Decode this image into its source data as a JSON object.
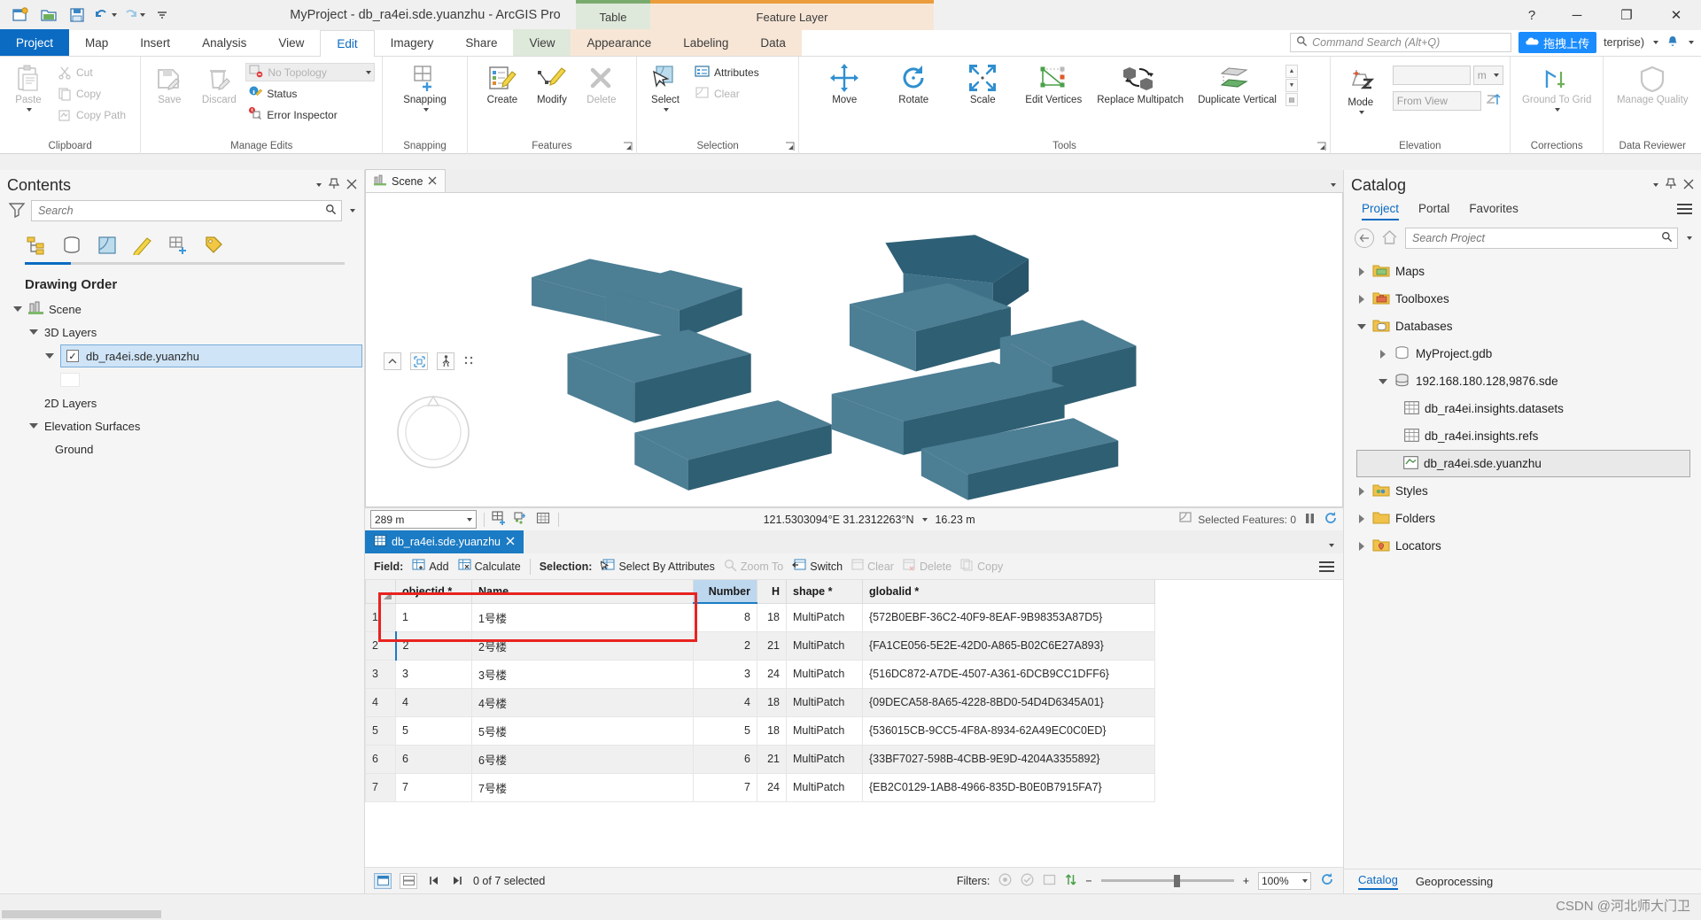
{
  "app": {
    "title": "MyProject - db_ra4ei.sde.yuanzhu - ArcGIS Pro",
    "help_glyph": "?",
    "minimize_glyph": "─",
    "maximize_glyph": "❐",
    "close_glyph": "✕"
  },
  "quick_access": [
    {
      "name": "new-project-icon",
      "label": "New Project"
    },
    {
      "name": "open-project-icon",
      "label": "Open Project"
    },
    {
      "name": "save-project-icon",
      "label": "Save Project"
    },
    {
      "name": "undo-icon",
      "label": "Undo"
    },
    {
      "name": "redo-icon",
      "label": "Redo"
    },
    {
      "name": "customize-qat-icon",
      "label": "Customize Quick Access Toolbar"
    }
  ],
  "contextual_groups": [
    {
      "label": "Table",
      "color": "#7aab6e"
    },
    {
      "label": "Feature Layer",
      "color": "#eb9c3c"
    }
  ],
  "tabs": [
    {
      "label": "Project",
      "state": "backstage"
    },
    {
      "label": "Map",
      "state": "normal"
    },
    {
      "label": "Insert",
      "state": "normal"
    },
    {
      "label": "Analysis",
      "state": "normal"
    },
    {
      "label": "View",
      "state": "normal"
    },
    {
      "label": "Edit",
      "state": "active"
    },
    {
      "label": "Imagery",
      "state": "normal"
    },
    {
      "label": "Share",
      "state": "normal"
    },
    {
      "label": "View",
      "state": "ctx-green"
    },
    {
      "label": "Appearance",
      "state": "ctx-orange"
    },
    {
      "label": "Labeling",
      "state": "ctx-orange"
    },
    {
      "label": "Data",
      "state": "ctx-orange"
    }
  ],
  "command_search": {
    "placeholder": "Command Search (Alt+Q)",
    "icon": "search-icon"
  },
  "header_right": {
    "upload_chip": "拖拽上传",
    "enterprise_label": "terprise)",
    "notification_icon": "bell-icon"
  },
  "ribbon": {
    "groups": [
      {
        "name": "clipboard",
        "label": "Clipboard",
        "big": [
          {
            "label": "Paste",
            "icon": "paste-icon",
            "dropdown": true,
            "disabled": true
          }
        ],
        "small": [
          {
            "label": "Cut",
            "icon": "cut-icon",
            "disabled": true
          },
          {
            "label": "Copy",
            "icon": "copy-icon",
            "disabled": true
          },
          {
            "label": "Copy Path",
            "icon": "copy-path-icon",
            "disabled": true
          }
        ]
      },
      {
        "name": "manage-edits",
        "label": "Manage Edits",
        "big": [
          {
            "label": "Save",
            "icon": "save-edits-icon",
            "disabled": true
          },
          {
            "label": "Discard",
            "icon": "discard-edits-icon",
            "disabled": true
          }
        ],
        "small": [
          {
            "label": "No Topology",
            "icon": "topology-icon",
            "disabled": true,
            "dropdown": true
          },
          {
            "label": "Status",
            "icon": "status-icon",
            "disabled": false
          },
          {
            "label": "Error Inspector",
            "icon": "error-inspector-icon",
            "disabled": false
          }
        ]
      },
      {
        "name": "snapping",
        "label": "Snapping",
        "big": [
          {
            "label": "Snapping",
            "icon": "snapping-icon",
            "dropdown": true
          }
        ],
        "small": []
      },
      {
        "name": "features",
        "label": "Features",
        "big": [
          {
            "label": "Create",
            "icon": "create-features-icon"
          },
          {
            "label": "Modify",
            "icon": "modify-features-icon"
          },
          {
            "label": "Delete",
            "icon": "delete-features-icon",
            "disabled": true
          }
        ],
        "small": []
      },
      {
        "name": "selection",
        "label": "Selection",
        "big": [
          {
            "label": "Select",
            "icon": "select-icon",
            "dropdown": true
          }
        ],
        "small": [
          {
            "label": "Attributes",
            "icon": "attributes-icon"
          },
          {
            "label": "Clear",
            "icon": "clear-selection-icon",
            "disabled": true
          }
        ]
      },
      {
        "name": "tools",
        "label": "Tools",
        "big": [
          {
            "label": "Move",
            "icon": "move-icon"
          },
          {
            "label": "Rotate",
            "icon": "rotate-icon"
          },
          {
            "label": "Scale",
            "icon": "scale-icon"
          },
          {
            "label": "Edit Vertices",
            "icon": "edit-vertices-icon"
          },
          {
            "label": "Replace Multipatch",
            "icon": "replace-multipatch-icon"
          },
          {
            "label": "Duplicate Vertical",
            "icon": "duplicate-vertical-icon"
          }
        ],
        "small": []
      },
      {
        "name": "elevation",
        "label": "Elevation",
        "big": [
          {
            "label": "Mode",
            "icon": "elevation-mode-icon",
            "dropdown": true
          }
        ],
        "fields": [
          {
            "name": "elevation-value",
            "value": "",
            "unit": "m"
          },
          {
            "name": "elevation-source",
            "value": "From View"
          }
        ]
      },
      {
        "name": "corrections",
        "label": "Corrections",
        "big": [
          {
            "label": "Ground To Grid",
            "icon": "ground-to-grid-icon",
            "dropdown": true,
            "disabled": true
          }
        ],
        "small": []
      },
      {
        "name": "data-reviewer",
        "label": "Data Reviewer",
        "big": [
          {
            "label": "Manage Quality",
            "icon": "manage-quality-icon",
            "disabled": true
          }
        ],
        "small": []
      }
    ]
  },
  "contents": {
    "title": "Contents",
    "search_placeholder": "Search",
    "tab_icons": [
      "list-by-drawing-order-icon",
      "list-by-data-source-icon",
      "list-by-selection-icon",
      "list-by-editing-icon",
      "list-by-snapping-icon",
      "list-by-labeling-icon"
    ],
    "section_title": "Drawing Order",
    "tree": [
      {
        "label": "Scene",
        "level": 0,
        "icon": "scene-icon",
        "expanded": true
      },
      {
        "label": "3D Layers",
        "level": 1,
        "expanded": true
      },
      {
        "label": "db_ra4ei.sde.yuanzhu",
        "level": 2,
        "expanded": true,
        "checked": true,
        "selected": true
      },
      {
        "label": "2D Layers",
        "level": 1,
        "expanded": false
      },
      {
        "label": "Elevation Surfaces",
        "level": 1,
        "expanded": true
      },
      {
        "label": "Ground",
        "level": 2
      }
    ]
  },
  "scene_view": {
    "tab_label": "Scene",
    "tab_icon": "scene-tab-icon",
    "scale": "289 m",
    "coordinates": "121.5303094°E 31.2312263°N",
    "elevation": "16.23 m",
    "selected_features": "Selected Features: 0",
    "nav_icons": [
      "collapse-icon",
      "full-control-icon",
      "walk-mode-icon",
      "more-nav-icon"
    ],
    "bottom_icons": [
      "add-layer-icon",
      "xy-events-icon",
      "grid-icon"
    ],
    "pause_icon": "pause-drawing-icon",
    "refresh_icon": "refresh-icon"
  },
  "table": {
    "tab_label": "db_ra4ei.sde.yuanzhu",
    "tab_icon": "table-icon",
    "toolbar": {
      "field_label": "Field:",
      "add": "Add",
      "calculate": "Calculate",
      "selection_label": "Selection:",
      "select_by_attributes": "Select By Attributes",
      "zoom_to": "Zoom To",
      "switch": "Switch",
      "clear": "Clear",
      "delete": "Delete",
      "copy": "Copy",
      "menu_icon": "table-options-icon"
    },
    "columns": [
      {
        "label": "objectid *",
        "key": "objectid",
        "align": "left"
      },
      {
        "label": "Name",
        "key": "name",
        "align": "left"
      },
      {
        "label": "Number",
        "key": "number",
        "align": "right",
        "highlighted": true
      },
      {
        "label": "H",
        "key": "h",
        "align": "right"
      },
      {
        "label": "shape *",
        "key": "shape",
        "align": "left"
      },
      {
        "label": "globalid *",
        "key": "globalid",
        "align": "left"
      }
    ],
    "rows": [
      {
        "row": "1",
        "objectid": "1",
        "name": "1号楼",
        "number": "8",
        "h": "18",
        "shape": "MultiPatch",
        "globalid": "{572B0EBF-36C2-40F9-8EAF-9B98353A87D5}"
      },
      {
        "row": "2",
        "objectid": "2",
        "name": "2号楼",
        "number": "2",
        "h": "21",
        "shape": "MultiPatch",
        "globalid": "{FA1CE056-5E2E-42D0-A865-B02C6E27A893}"
      },
      {
        "row": "3",
        "objectid": "3",
        "name": "3号楼",
        "number": "3",
        "h": "24",
        "shape": "MultiPatch",
        "globalid": "{516DC872-A7DE-4507-A361-6DCB9CC1DFF6}"
      },
      {
        "row": "4",
        "objectid": "4",
        "name": "4号楼",
        "number": "4",
        "h": "18",
        "shape": "MultiPatch",
        "globalid": "{09DECA58-8A65-4228-8BD0-54D4D6345A01}"
      },
      {
        "row": "5",
        "objectid": "5",
        "name": "5号楼",
        "number": "5",
        "h": "18",
        "shape": "MultiPatch",
        "globalid": "{536015CB-9CC5-4F8A-8934-62A49EC0C0ED}"
      },
      {
        "row": "6",
        "objectid": "6",
        "name": "6号楼",
        "number": "6",
        "h": "21",
        "shape": "MultiPatch",
        "globalid": "{33BF7027-598B-4CBB-9E9D-4204A3355892}"
      },
      {
        "row": "7",
        "objectid": "7",
        "name": "7号楼",
        "number": "7",
        "h": "24",
        "shape": "MultiPatch",
        "globalid": "{EB2C0129-1AB8-4966-835D-B0E0B7915FA7}"
      }
    ],
    "status": {
      "selected_text": "0 of 7 selected",
      "filters_label": "Filters:",
      "zoom": "100%",
      "minus": "−",
      "plus": "+",
      "view_table_icon": "view-table-icon",
      "view_related_icon": "view-related-icon",
      "first_icon": "first-record-icon",
      "next_icon": "next-record-icon",
      "refresh_icon": "refresh-table-icon"
    }
  },
  "catalog": {
    "title": "Catalog",
    "tabs": [
      {
        "label": "Project",
        "active": true
      },
      {
        "label": "Portal",
        "active": false
      },
      {
        "label": "Favorites",
        "active": false
      }
    ],
    "search_placeholder": "Search Project",
    "back_icon": "back-icon",
    "home_icon": "home-icon",
    "tree": [
      {
        "label": "Maps",
        "level": 0,
        "icon": "folder-maps-icon",
        "expanded": false
      },
      {
        "label": "Toolboxes",
        "level": 0,
        "icon": "folder-toolboxes-icon",
        "expanded": false
      },
      {
        "label": "Databases",
        "level": 0,
        "icon": "folder-databases-icon",
        "expanded": true
      },
      {
        "label": "MyProject.gdb",
        "level": 1,
        "icon": "gdb-icon",
        "expanded": false
      },
      {
        "label": "192.168.180.128,9876.sde",
        "level": 1,
        "icon": "sde-icon",
        "expanded": true
      },
      {
        "label": "db_ra4ei.insights.datasets",
        "level": 2,
        "icon": "table-dataset-icon"
      },
      {
        "label": "db_ra4ei.insights.refs",
        "level": 2,
        "icon": "table-dataset-icon"
      },
      {
        "label": "db_ra4ei.sde.yuanzhu",
        "level": 2,
        "icon": "multipatch-layer-icon",
        "selected": true
      },
      {
        "label": "Styles",
        "level": 0,
        "icon": "folder-styles-icon",
        "expanded": false
      },
      {
        "label": "Folders",
        "level": 0,
        "icon": "folder-folders-icon",
        "expanded": false
      },
      {
        "label": "Locators",
        "level": 0,
        "icon": "folder-locators-icon",
        "expanded": false
      }
    ],
    "bottom_tabs": [
      {
        "label": "Catalog",
        "active": true
      },
      {
        "label": "Geoprocessing",
        "active": false
      }
    ]
  },
  "watermark": "CSDN @河北师大门卫",
  "colors": {
    "accent": "#0b6bc3",
    "building_light": "#4c7e94",
    "building_dark": "#2d5a6e",
    "selection_blue": "#bdd7ee",
    "red_highlight": "#e8231f"
  }
}
